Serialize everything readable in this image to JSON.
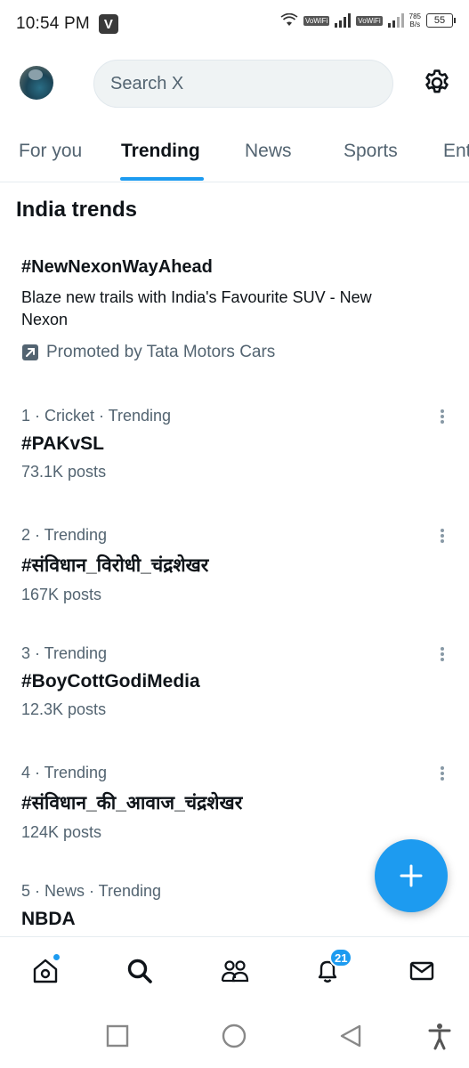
{
  "status_bar": {
    "time": "10:54 PM",
    "carrier_badge": "V",
    "vowifi_label": "VoWiFi",
    "net_speed_value": "785",
    "net_speed_unit": "B/s",
    "battery": "55"
  },
  "header": {
    "search_placeholder": "Search X"
  },
  "tabs": [
    {
      "label": "For you",
      "active": false
    },
    {
      "label": "Trending",
      "active": true
    },
    {
      "label": "News",
      "active": false
    },
    {
      "label": "Sports",
      "active": false
    },
    {
      "label": "Ent",
      "active": false
    }
  ],
  "section_title": "India trends",
  "promoted": {
    "tag": "#NewNexonWayAhead",
    "description": "Blaze new trails with India's Favourite SUV - New Nexon",
    "promoted_by": "Promoted by Tata Motors Cars"
  },
  "trends": [
    {
      "meta": "1 · Cricket · Trending",
      "name": "#PAKvSL",
      "posts": "73.1K posts"
    },
    {
      "meta": "2 · Trending",
      "name": "#संविधान_विरोधी_चंद्रशेखर",
      "posts": "167K posts"
    },
    {
      "meta": "3 · Trending",
      "name": "#BoyCottGodiMedia",
      "posts": "12.3K posts"
    },
    {
      "meta": "4 · Trending",
      "name": "#संविधान_की_आवाज_चंद्रशेखर",
      "posts": "124K posts"
    },
    {
      "meta": "5 · News · Trending",
      "name": "NBDA",
      "posts": ""
    }
  ],
  "bottom_nav": {
    "notifications_count": "21",
    "icons": [
      "home-icon",
      "search-icon",
      "communities-icon",
      "notifications-icon",
      "messages-icon"
    ]
  },
  "colors": {
    "accent": "#1d9bf0",
    "text_primary": "#0f1419",
    "text_secondary": "#536471"
  }
}
